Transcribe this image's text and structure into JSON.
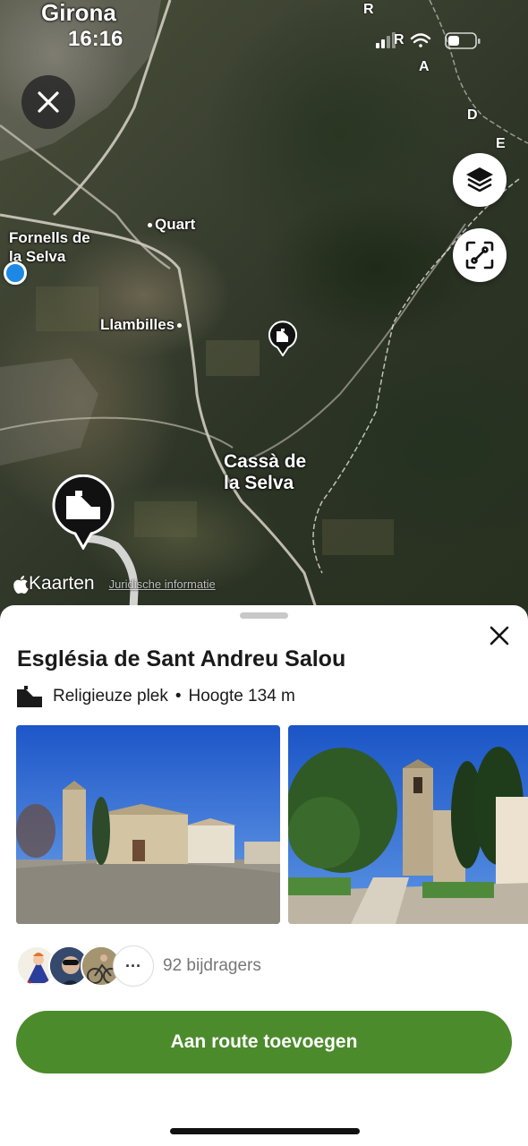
{
  "status": {
    "time": "16:16"
  },
  "map": {
    "places": {
      "girona": "Girona",
      "quart": "Quart",
      "fornells": "Fornells de la Selva",
      "fornells_l1": "Fornells de",
      "fornells_l2": "la Selva",
      "llambilles": "Llambilles",
      "cassa_l1": "Cassà de",
      "cassa_l2": "la Selva"
    },
    "region_letters": [
      "R",
      "R",
      "A",
      "D",
      "E"
    ],
    "attribution": {
      "brand": "Kaarten",
      "legal": "Juridische informatie"
    },
    "icons": {
      "close": "close-icon",
      "layers": "layers-icon",
      "scan": "scan-icon",
      "location": "current-location-icon",
      "pin": "religious-place-pin-icon"
    }
  },
  "sheet": {
    "title": "Església de Sant Andreu Salou",
    "category": "Religieuze plek",
    "separator": "•",
    "elevation": "Hoogte 134 m",
    "contributors_label": "92 bijdragers",
    "more_label": "···",
    "cta_label": "Aan route toevoegen"
  },
  "colors": {
    "accent": "#4b8b2b",
    "location_blue": "#1e88e5"
  }
}
